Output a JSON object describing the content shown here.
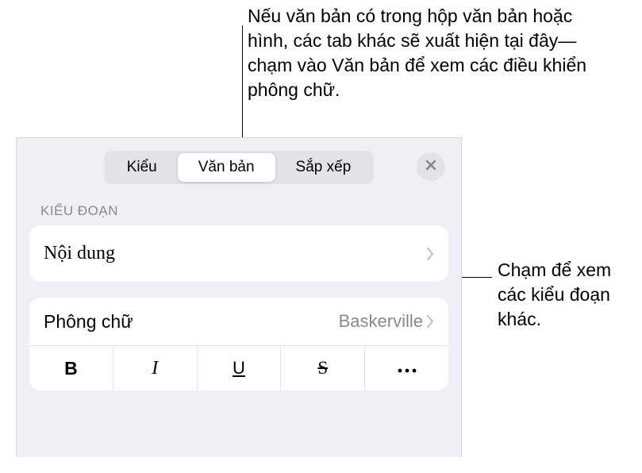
{
  "callouts": {
    "top": "Nếu văn bản có trong hộp văn bản hoặc hình, các tab khác sẽ xuất hiện tại đây—chạm vào Văn bản để xem các điều khiển phông chữ.",
    "right": "Chạm để xem các kiểu đoạn khác."
  },
  "tabs": {
    "items": [
      "Kiểu",
      "Văn bản",
      "Sắp xếp"
    ],
    "active_index": 1
  },
  "section": {
    "paragraph_label": "KIỂU ĐOẠN"
  },
  "paragraph_style": {
    "value": "Nội dung"
  },
  "font": {
    "label": "Phông chữ",
    "value": "Baskerville"
  },
  "style_buttons": {
    "bold": "B",
    "italic": "I",
    "underline": "U",
    "strike": "S"
  }
}
